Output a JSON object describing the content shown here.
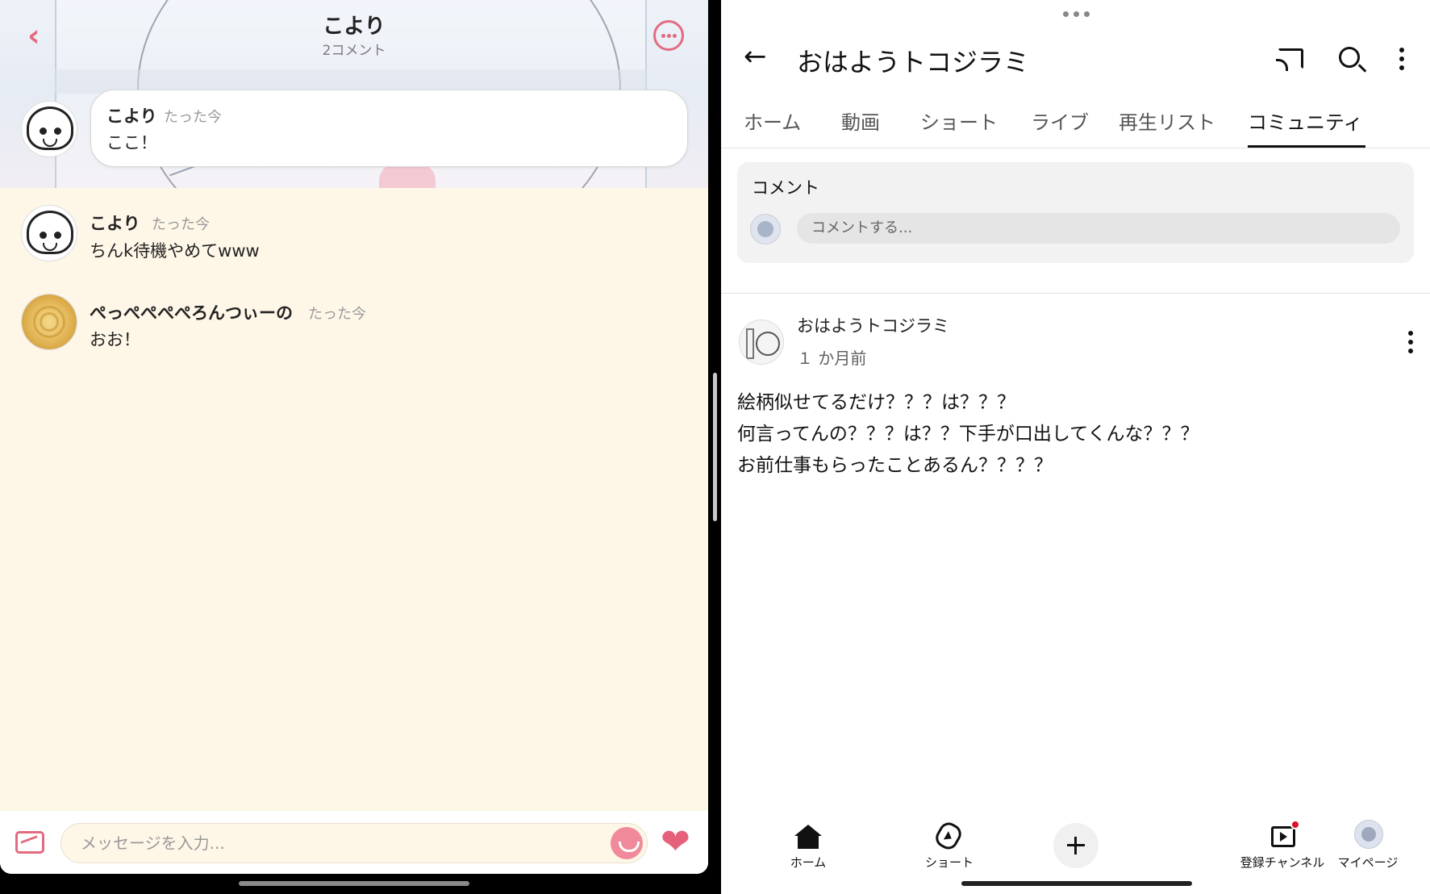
{
  "left_app": {
    "header": {
      "title": "こより",
      "comment_count": "2コメント"
    },
    "pinned_comment": {
      "author": "こより",
      "time": "たった今",
      "text": "ここ！"
    },
    "comments": [
      {
        "author": "こより",
        "time": "たった今",
        "text": "ちんk待機やめてwww",
        "avatar": "sketch-face"
      },
      {
        "author": "ぺっぺぺぺぺろんつぃーの",
        "time": "たった今",
        "text": "おお！",
        "avatar": "pasta"
      }
    ],
    "composer": {
      "placeholder": "メッセージを入力..."
    },
    "colors": {
      "accent": "#e36b80",
      "background": "#fef7e8"
    }
  },
  "right_app": {
    "header": {
      "channel_title": "おはようトコジラミ"
    },
    "tabs": [
      {
        "label": "ホーム",
        "active": false
      },
      {
        "label": "動画",
        "active": false
      },
      {
        "label": "ショート",
        "active": false
      },
      {
        "label": "ライブ",
        "active": false
      },
      {
        "label": "再生リスト",
        "active": false
      },
      {
        "label": "コミュニティ",
        "active": true
      }
    ],
    "comment_box": {
      "label": "コメント",
      "placeholder": "コメントする..."
    },
    "post": {
      "channel": "おはようトコジラミ",
      "age": "１ か月前",
      "lines": [
        "絵柄似せてるだけ？？？は？？？",
        "何言ってんの？？？は？？下手が口出してくんな？？？",
        "お前仕事もらったことあるん？？？？"
      ]
    },
    "bottom_nav": [
      {
        "label": "ホーム",
        "icon": "home-icon"
      },
      {
        "label": "ショート",
        "icon": "shorts-icon"
      },
      {
        "label": "",
        "icon": "create-icon"
      },
      {
        "label": "登録チャンネル",
        "icon": "subscriptions-icon"
      },
      {
        "label": "マイページ",
        "icon": "avatar"
      }
    ],
    "colors": {
      "notification": "#e0102a",
      "text": "#111111"
    }
  }
}
